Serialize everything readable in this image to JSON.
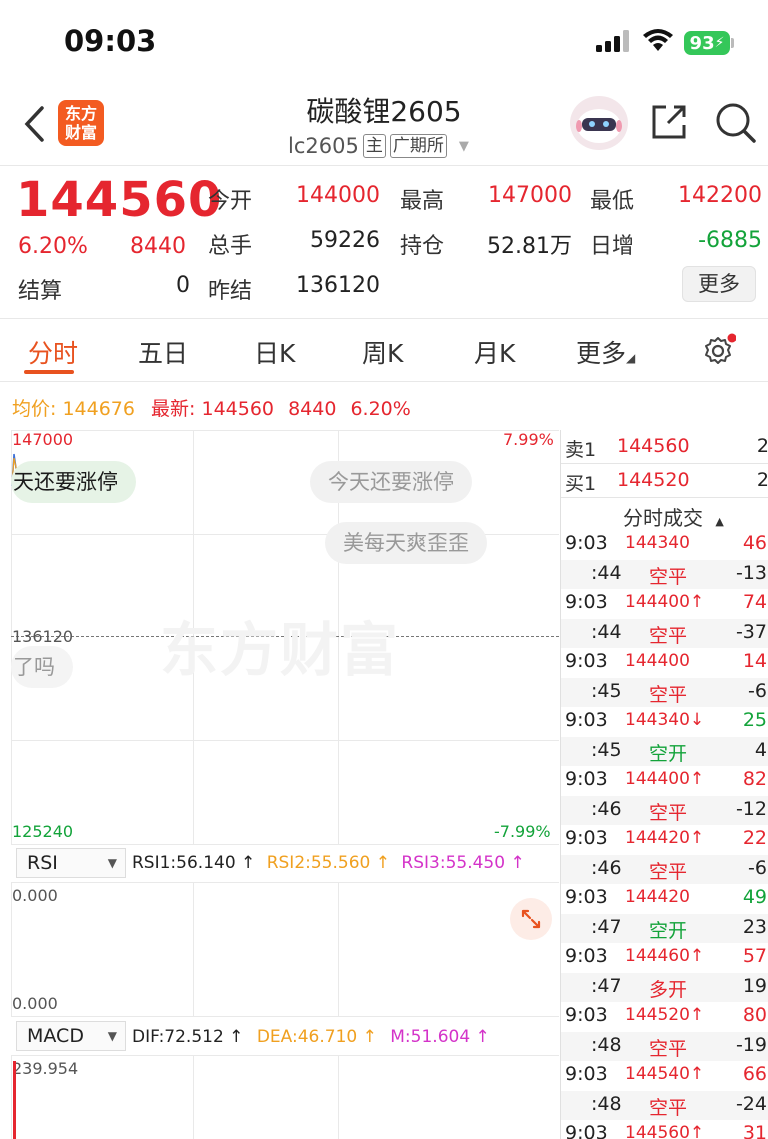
{
  "status_bar": {
    "time": "09:03",
    "battery": "93"
  },
  "header": {
    "back_icon": "chevron-left-icon",
    "logo_text": [
      "东方",
      "财富"
    ],
    "title": "碳酸锂2605",
    "code": "lc2605",
    "tag_main": "主",
    "tag_exchange": "广期所",
    "share_icon": "share-icon",
    "search_icon": "search-icon"
  },
  "quote": {
    "price": "144560",
    "change_pct": "6.20%",
    "change": "8440",
    "settle_label": "结算",
    "settle_value": "0",
    "open_label": "今开",
    "open_value": "144000",
    "high_label": "最高",
    "high_value": "147000",
    "low_label": "最低",
    "low_value": "142200",
    "volume_label": "总手",
    "volume_value": "59226",
    "oi_label": "持仓",
    "oi_value": "52.81万",
    "daily_inc_label": "日增",
    "daily_inc_value": "-6885",
    "prev_settle_label": "昨结",
    "prev_settle_value": "136120",
    "more_button": "更多"
  },
  "tabs": [
    "分时",
    "五日",
    "日K",
    "周K",
    "月K",
    "更多"
  ],
  "chart": {
    "summary": {
      "avg_label": "均价:",
      "avg_value": "144676",
      "latest_label": "最新:",
      "latest_value": "144560",
      "latest_change": "8440",
      "latest_pct": "6.20%"
    },
    "y_top": "147000",
    "y_mid": "136120",
    "y_bottom": "125240",
    "pct_top": "7.99%",
    "pct_bottom": "-7.99%",
    "watermark": "东方财富",
    "bubbles": [
      "天还要涨停",
      "今天还要涨停",
      "美每天爽歪歪",
      "了吗"
    ]
  },
  "rsi": {
    "selector": "RSI",
    "rsi1": "RSI1:56.140 ↑",
    "rsi2": "RSI2:55.560 ↑",
    "rsi3": "RSI3:55.450 ↑",
    "top_value": "0.000",
    "bottom_value": "0.000"
  },
  "macd": {
    "selector": "MACD",
    "dif": "DIF:72.512 ↑",
    "dea": "DEA:46.710 ↑",
    "m": "M:51.604 ↑",
    "top_value": "239.954"
  },
  "order_book": {
    "ask_label": "卖1",
    "ask_price": "144560",
    "ask_vol": "2",
    "bid_label": "买1",
    "bid_price": "144520",
    "bid_vol": "2"
  },
  "trades_header": "分时成交",
  "trades": [
    {
      "time": "9:03",
      "price": "144340",
      "dir": "",
      "vol": "46",
      "vol_color": "red",
      "price_color": "red"
    },
    {
      "time": ":44",
      "type": "空平",
      "type_color": "red",
      "vol": "-13"
    },
    {
      "time": "9:03",
      "price": "144400↑",
      "vol": "74",
      "vol_color": "red",
      "price_color": "red"
    },
    {
      "time": ":44",
      "type": "空平",
      "type_color": "red",
      "vol": "-37"
    },
    {
      "time": "9:03",
      "price": "144400",
      "vol": "14",
      "vol_color": "red",
      "price_color": "red"
    },
    {
      "time": ":45",
      "type": "空平",
      "type_color": "red",
      "vol": "-6"
    },
    {
      "time": "9:03",
      "price": "144340↓",
      "vol": "25",
      "vol_color": "green",
      "price_color": "red"
    },
    {
      "time": ":45",
      "type": "空开",
      "type_color": "green",
      "vol": "4"
    },
    {
      "time": "9:03",
      "price": "144400↑",
      "vol": "82",
      "vol_color": "red",
      "price_color": "red"
    },
    {
      "time": ":46",
      "type": "空平",
      "type_color": "red",
      "vol": "-12"
    },
    {
      "time": "9:03",
      "price": "144420↑",
      "vol": "22",
      "vol_color": "red",
      "price_color": "red"
    },
    {
      "time": ":46",
      "type": "空平",
      "type_color": "red",
      "vol": "-6"
    },
    {
      "time": "9:03",
      "price": "144420",
      "vol": "49",
      "vol_color": "green",
      "price_color": "red"
    },
    {
      "time": ":47",
      "type": "空开",
      "type_color": "green",
      "vol": "23"
    },
    {
      "time": "9:03",
      "price": "144460↑",
      "vol": "57",
      "vol_color": "red",
      "price_color": "red"
    },
    {
      "time": ":47",
      "type": "多开",
      "type_color": "red",
      "vol": "19"
    },
    {
      "time": "9:03",
      "price": "144520↑",
      "vol": "80",
      "vol_color": "red",
      "price_color": "red"
    },
    {
      "time": ":48",
      "type": "空平",
      "type_color": "red",
      "vol": "-19"
    },
    {
      "time": "9:03",
      "price": "144540↑",
      "vol": "66",
      "vol_color": "red",
      "price_color": "red"
    },
    {
      "time": ":48",
      "type": "空平",
      "type_color": "red",
      "vol": "-24"
    },
    {
      "time": "9:03",
      "price": "144560↑",
      "vol": "31",
      "vol_color": "red",
      "price_color": "red"
    }
  ],
  "colors": {
    "up": "#e5262f",
    "down": "#13a33a",
    "accent": "#e8521f",
    "avg": "#f0a020"
  }
}
